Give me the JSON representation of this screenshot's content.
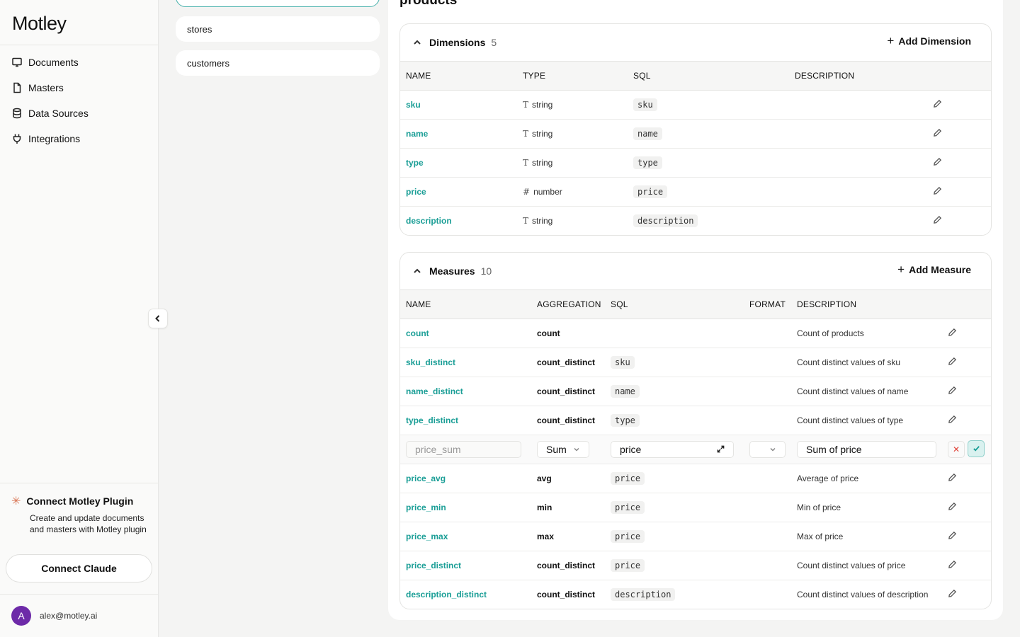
{
  "app": {
    "logo": "Motley"
  },
  "nav": [
    {
      "label": "Documents",
      "icon": "documents-icon"
    },
    {
      "label": "Masters",
      "icon": "file-icon"
    },
    {
      "label": "Data Sources",
      "icon": "database-icon"
    },
    {
      "label": "Integrations",
      "icon": "plug-icon"
    }
  ],
  "plugin": {
    "title": "Connect Motley Plugin",
    "description": "Create and update documents and masters with Motley plugin",
    "button": "Connect Claude"
  },
  "user": {
    "initial": "A",
    "email": "alex@motley.ai",
    "avatar_color": "#6d2aa8"
  },
  "models": [
    {
      "label": "stores"
    },
    {
      "label": "customers"
    }
  ],
  "page": {
    "title": "products"
  },
  "dimensions": {
    "title": "Dimensions",
    "count": "5",
    "add_label": "Add Dimension",
    "columns": [
      "NAME",
      "TYPE",
      "SQL",
      "DESCRIPTION"
    ],
    "rows": [
      {
        "name": "sku",
        "type_icon": "T",
        "type": "string",
        "sql": "sku",
        "description": ""
      },
      {
        "name": "name",
        "type_icon": "T",
        "type": "string",
        "sql": "name",
        "description": ""
      },
      {
        "name": "type",
        "type_icon": "T",
        "type": "string",
        "sql": "type",
        "description": ""
      },
      {
        "name": "price",
        "type_icon": "#",
        "type": "number",
        "sql": "price",
        "description": ""
      },
      {
        "name": "description",
        "type_icon": "T",
        "type": "string",
        "sql": "description",
        "description": ""
      }
    ]
  },
  "measures": {
    "title": "Measures",
    "count": "10",
    "add_label": "Add Measure",
    "columns": [
      "NAME",
      "AGGREGATION",
      "SQL",
      "FORMAT",
      "DESCRIPTION"
    ],
    "rows_before": [
      {
        "name": "count",
        "aggregation": "count",
        "sql": "",
        "description": "Count of products"
      },
      {
        "name": "sku_distinct",
        "aggregation": "count_distinct",
        "sql": "sku",
        "description": "Count distinct values of sku"
      },
      {
        "name": "name_distinct",
        "aggregation": "count_distinct",
        "sql": "name",
        "description": "Count distinct values of name"
      },
      {
        "name": "type_distinct",
        "aggregation": "count_distinct",
        "sql": "type",
        "description": "Count distinct values of type"
      }
    ],
    "editing": {
      "name_placeholder": "price_sum",
      "aggregation": "Sum",
      "sql": "price",
      "format": "",
      "description": "Sum of price"
    },
    "rows_after": [
      {
        "name": "price_avg",
        "aggregation": "avg",
        "sql": "price",
        "description": "Average of price"
      },
      {
        "name": "price_min",
        "aggregation": "min",
        "sql": "price",
        "description": "Min of price"
      },
      {
        "name": "price_max",
        "aggregation": "max",
        "sql": "price",
        "description": "Max of price"
      },
      {
        "name": "price_distinct",
        "aggregation": "count_distinct",
        "sql": "price",
        "description": "Count distinct values of price"
      },
      {
        "name": "description_distinct",
        "aggregation": "count_distinct",
        "sql": "description",
        "description": "Count distinct values of description"
      }
    ]
  },
  "colors": {
    "accent": "#1a9e96",
    "danger": "#e0443a"
  }
}
